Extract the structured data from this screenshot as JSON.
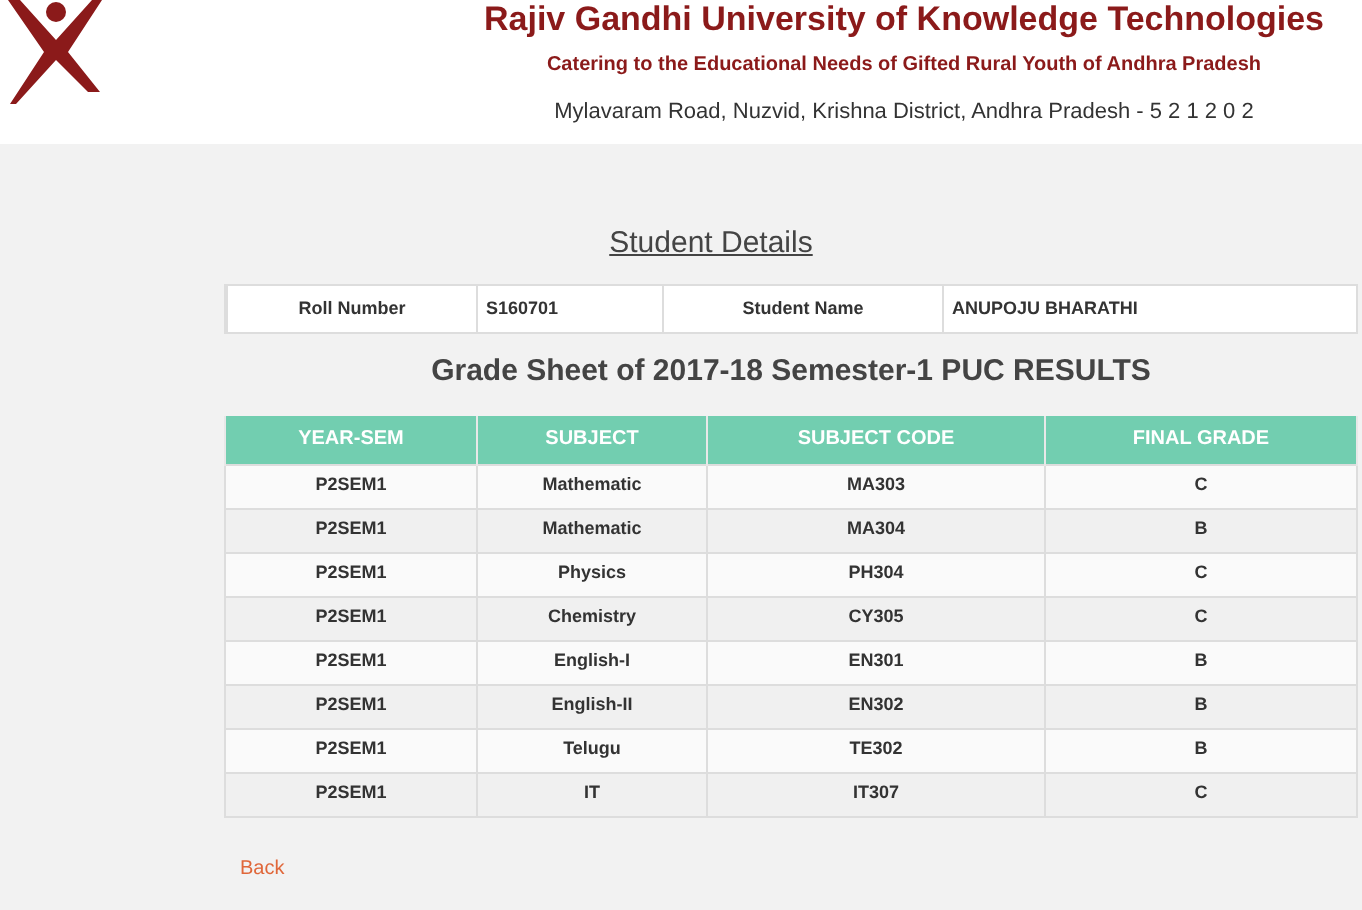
{
  "header": {
    "title": "Rajiv Gandhi University of Knowledge Technologies",
    "tagline": "Catering to the Educational Needs of Gifted Rural Youth of Andhra Pradesh",
    "address": "Mylavaram Road, Nuzvid, Krishna District, Andhra Pradesh - 5 2 1 2 0 2"
  },
  "section_title": "Student Details",
  "student_info": [
    "Roll Number",
    "S160701",
    "Student Name",
    "ANUPOJU BHARATHI"
  ],
  "grade_sheet_title": "Grade Sheet of 2017-18 Semester-1 PUC RESULTS",
  "table": {
    "columns": [
      "YEAR-SEM",
      "SUBJECT",
      "SUBJECT CODE",
      "FINAL GRADE"
    ],
    "rows": [
      [
        "P2SEM1",
        "Mathematic",
        "MA303",
        "C"
      ],
      [
        "P2SEM1",
        "Mathematic",
        "MA304",
        "B"
      ],
      [
        "P2SEM1",
        "Physics",
        "PH304",
        "C"
      ],
      [
        "P2SEM1",
        "Chemistry",
        "CY305",
        "C"
      ],
      [
        "P2SEM1",
        "English-I",
        "EN301",
        "B"
      ],
      [
        "P2SEM1",
        "English-II",
        "EN302",
        "B"
      ],
      [
        "P2SEM1",
        "Telugu",
        "TE302",
        "B"
      ],
      [
        "P2SEM1",
        "IT",
        "IT307",
        "C"
      ]
    ]
  },
  "back_link": "Back"
}
